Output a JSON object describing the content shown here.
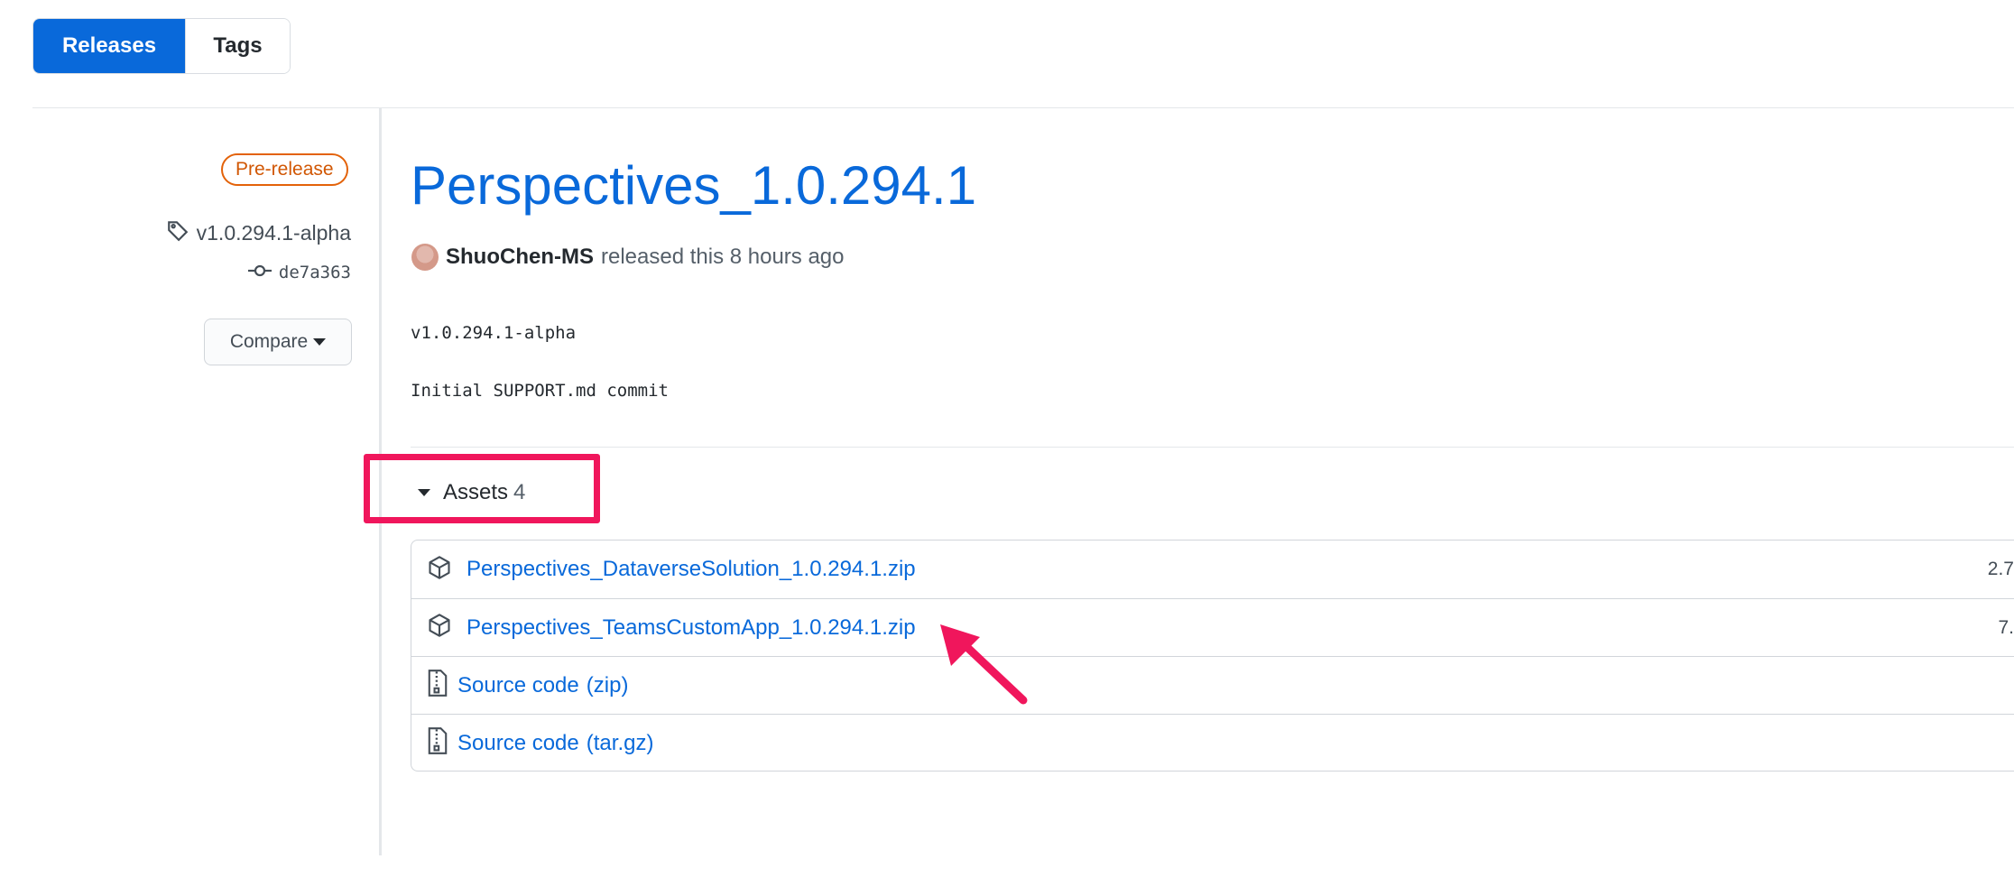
{
  "tabs": {
    "releases": "Releases",
    "tags": "Tags"
  },
  "sidebar": {
    "badge": "Pre-release",
    "tag": "v1.0.294.1-alpha",
    "commit": "de7a363",
    "compare": "Compare"
  },
  "release": {
    "title": "Perspectives_1.0.294.1",
    "author": "ShuoChen-MS",
    "released_text": "released this 8 hours ago",
    "body_tag": "v1.0.294.1-alpha",
    "body_commit": "Initial SUPPORT.md commit"
  },
  "assets": {
    "label": "Assets",
    "count": "4",
    "items": [
      {
        "name": "Perspectives_DataverseSolution_1.0.294.1.zip",
        "size": "2.7"
      },
      {
        "name": "Perspectives_TeamsCustomApp_1.0.294.1.zip",
        "size": "7."
      },
      {
        "name": "Source code",
        "suffix": "(zip)"
      },
      {
        "name": "Source code",
        "suffix": "(tar.gz)"
      }
    ]
  },
  "colors": {
    "accent": "#0969da",
    "prerelease": "#e36209",
    "highlight": "#f0165c"
  },
  "icons": [
    "tag-icon",
    "commit-icon",
    "package-icon",
    "file-zip-icon",
    "arrow-annotation-icon"
  ]
}
